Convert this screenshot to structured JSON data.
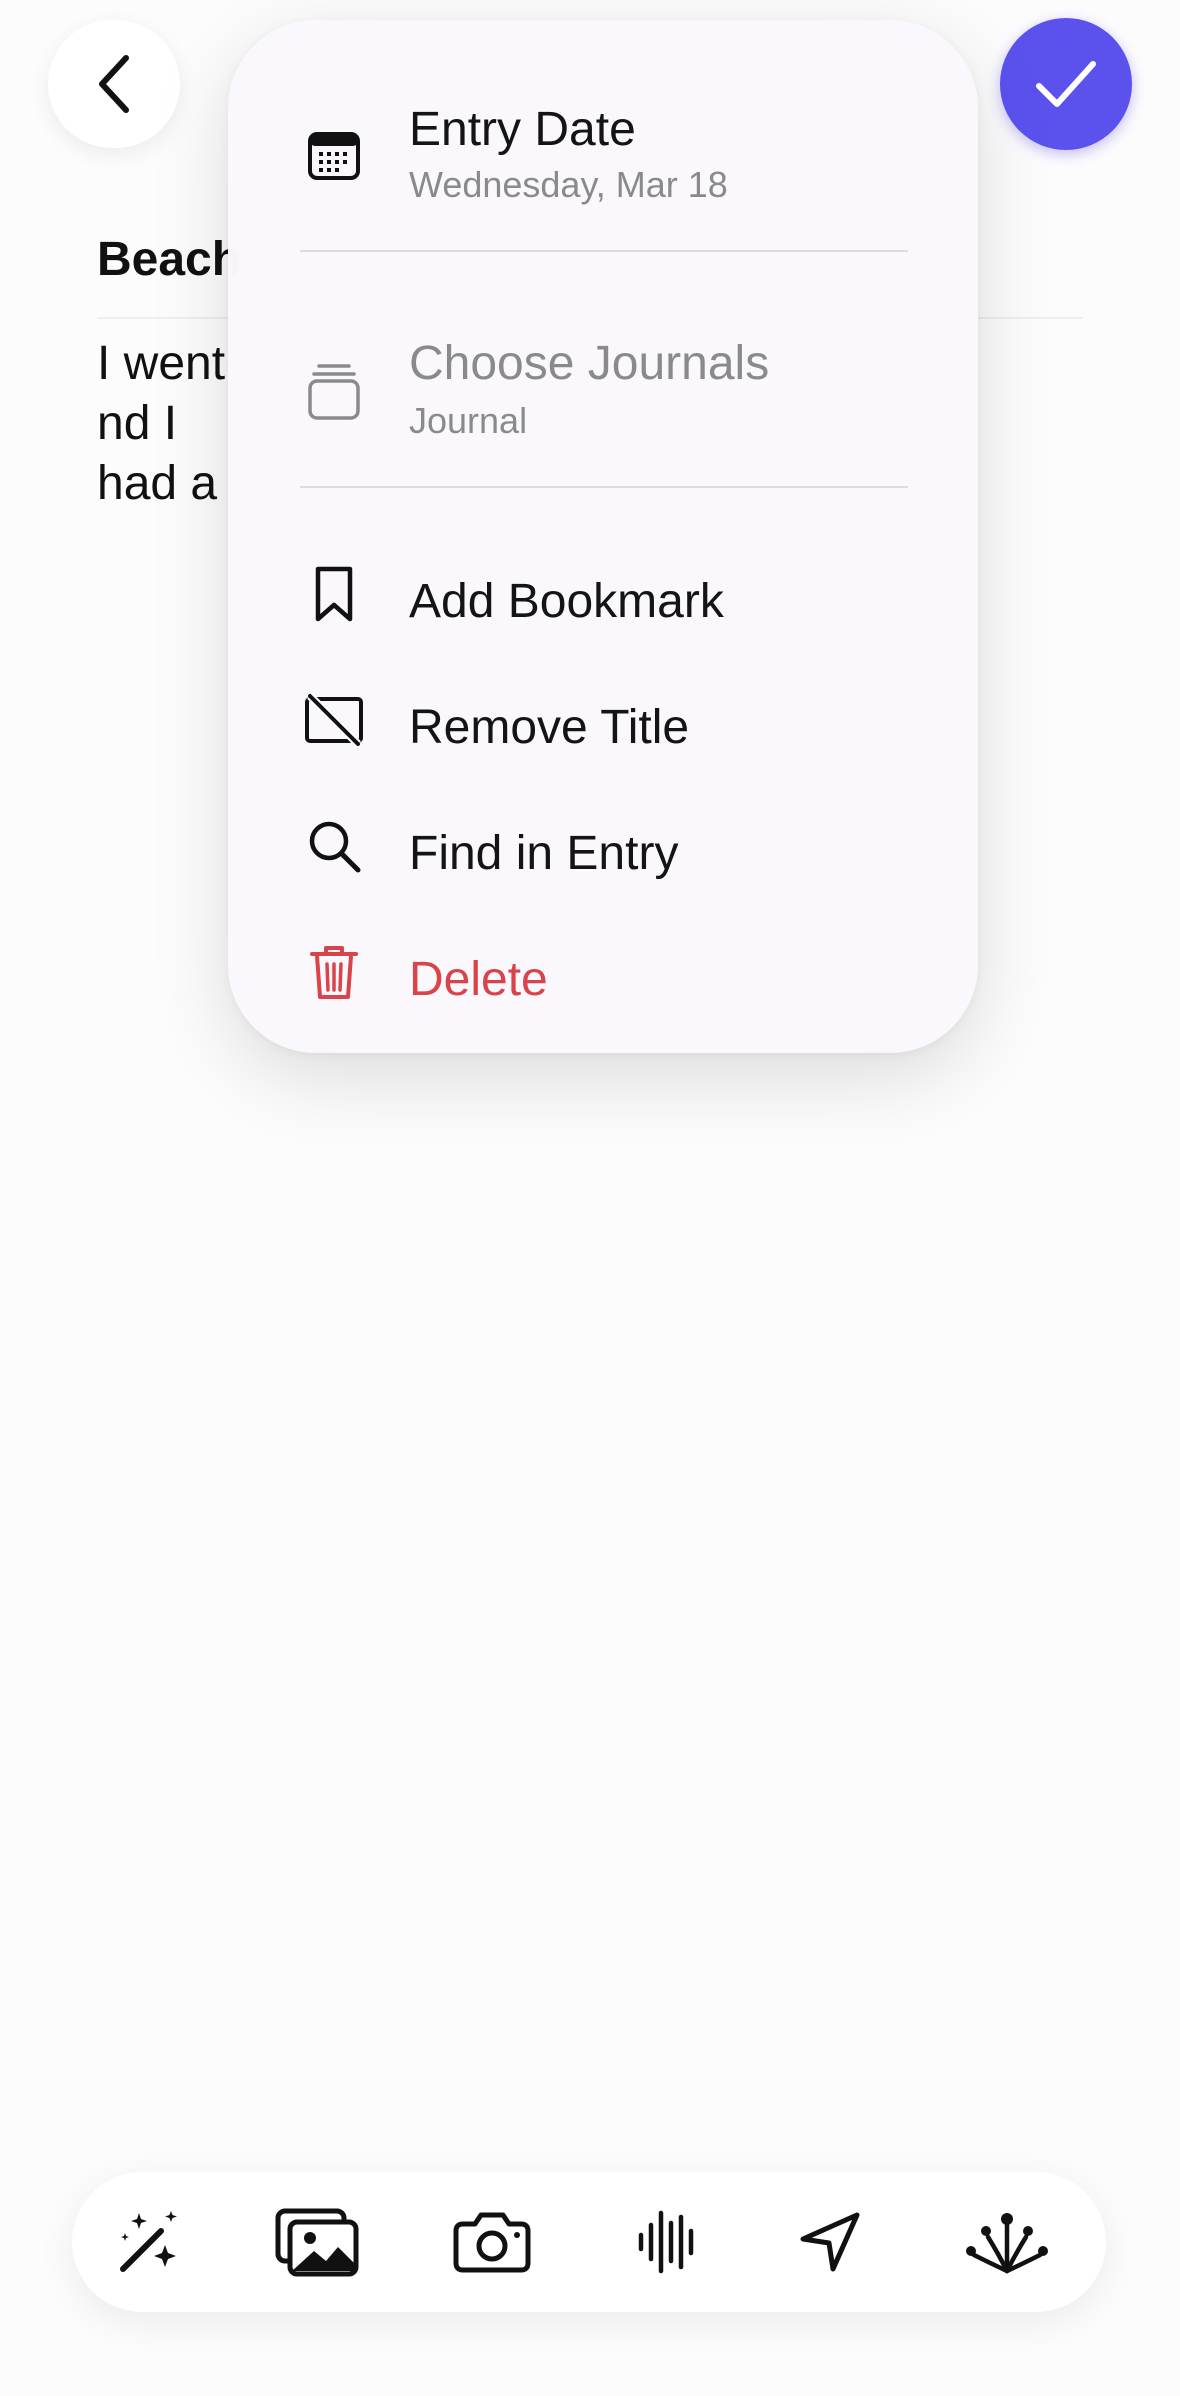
{
  "entry": {
    "title": "Beach",
    "body": "I went                                                              nd I\nhad a"
  },
  "menu": {
    "entry_date_label": "Entry Date",
    "entry_date_value": "Wednesday, Mar 18",
    "journals_label": "Choose Journals",
    "journals_value": "Journal",
    "bookmark_label": "Add Bookmark",
    "remove_title_label": "Remove Title",
    "find_label": "Find in Entry",
    "delete_label": "Delete"
  },
  "icons": {
    "back": "chevron-left-icon",
    "done": "checkmark-icon",
    "calendar": "calendar-icon",
    "journals": "journals-stack-icon",
    "bookmark": "bookmark-icon",
    "remove_title": "remove-title-icon",
    "find": "magnifier-icon",
    "delete": "trash-icon",
    "toolbar": [
      "magic-wand-icon",
      "photo-library-icon",
      "camera-icon",
      "audio-waveform-icon",
      "location-arrow-icon",
      "templates-icon"
    ]
  },
  "colors": {
    "accent": "#5b52ee",
    "destructive": "#d9434a",
    "disabled_text": "#8a8a8e"
  }
}
